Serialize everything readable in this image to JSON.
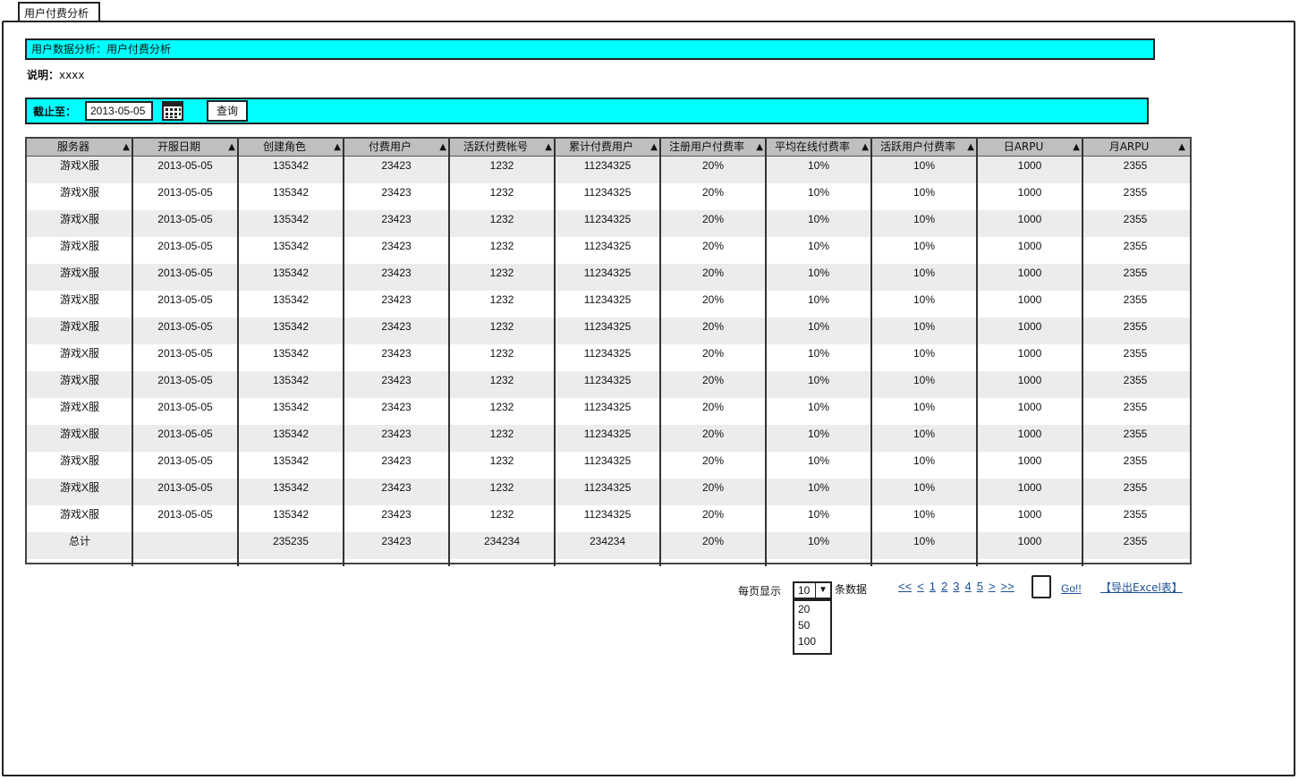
{
  "tab": {
    "label": "用户付费分析"
  },
  "title_bar": {
    "text": "用户数据分析：用户付费分析"
  },
  "description": {
    "label": "说明：",
    "value": "xxxx"
  },
  "query": {
    "label": "截止至：",
    "date_value": "2013-05-05",
    "calendar_icon": "calendar-icon",
    "button_label": "查询"
  },
  "table": {
    "columns": [
      "服务器",
      "开服日期",
      "创建角色",
      "付费用户",
      "活跃付费帐号",
      "累计付费用户",
      "注册用户付费率",
      "平均在线付费率",
      "活跃用户付费率",
      "日ARPU",
      "月ARPU"
    ],
    "sort_icon": "▲",
    "rows": [
      [
        "游戏X服",
        "2013-05-05",
        "135342",
        "23423",
        "1232",
        "11234325",
        "20%",
        "10%",
        "10%",
        "1000",
        "2355"
      ],
      [
        "游戏X服",
        "2013-05-05",
        "135342",
        "23423",
        "1232",
        "11234325",
        "20%",
        "10%",
        "10%",
        "1000",
        "2355"
      ],
      [
        "游戏X服",
        "2013-05-05",
        "135342",
        "23423",
        "1232",
        "11234325",
        "20%",
        "10%",
        "10%",
        "1000",
        "2355"
      ],
      [
        "游戏X服",
        "2013-05-05",
        "135342",
        "23423",
        "1232",
        "11234325",
        "20%",
        "10%",
        "10%",
        "1000",
        "2355"
      ],
      [
        "游戏X服",
        "2013-05-05",
        "135342",
        "23423",
        "1232",
        "11234325",
        "20%",
        "10%",
        "10%",
        "1000",
        "2355"
      ],
      [
        "游戏X服",
        "2013-05-05",
        "135342",
        "23423",
        "1232",
        "11234325",
        "20%",
        "10%",
        "10%",
        "1000",
        "2355"
      ],
      [
        "游戏X服",
        "2013-05-05",
        "135342",
        "23423",
        "1232",
        "11234325",
        "20%",
        "10%",
        "10%",
        "1000",
        "2355"
      ],
      [
        "游戏X服",
        "2013-05-05",
        "135342",
        "23423",
        "1232",
        "11234325",
        "20%",
        "10%",
        "10%",
        "1000",
        "2355"
      ],
      [
        "游戏X服",
        "2013-05-05",
        "135342",
        "23423",
        "1232",
        "11234325",
        "20%",
        "10%",
        "10%",
        "1000",
        "2355"
      ],
      [
        "游戏X服",
        "2013-05-05",
        "135342",
        "23423",
        "1232",
        "11234325",
        "20%",
        "10%",
        "10%",
        "1000",
        "2355"
      ],
      [
        "游戏X服",
        "2013-05-05",
        "135342",
        "23423",
        "1232",
        "11234325",
        "20%",
        "10%",
        "10%",
        "1000",
        "2355"
      ],
      [
        "游戏X服",
        "2013-05-05",
        "135342",
        "23423",
        "1232",
        "11234325",
        "20%",
        "10%",
        "10%",
        "1000",
        "2355"
      ],
      [
        "游戏X服",
        "2013-05-05",
        "135342",
        "23423",
        "1232",
        "11234325",
        "20%",
        "10%",
        "10%",
        "1000",
        "2355"
      ],
      [
        "游戏X服",
        "2013-05-05",
        "135342",
        "23423",
        "1232",
        "11234325",
        "20%",
        "10%",
        "10%",
        "1000",
        "2355"
      ]
    ],
    "total_row": [
      "总计",
      "",
      "235235",
      "23423",
      "234234",
      "234234",
      "20%",
      "10%",
      "10%",
      "1000",
      "2355"
    ]
  },
  "pager": {
    "per_page_label": "每页显示",
    "per_page_value": "10",
    "per_page_options": [
      "20",
      "50",
      "100"
    ],
    "rows_label": "条数据",
    "links": [
      "<<",
      "<",
      "1",
      "2",
      "3",
      "4",
      "5",
      ">",
      ">>"
    ],
    "go_label": "Go!!",
    "export_label": "【导出Excel表】"
  },
  "colors": {
    "accent": "#00ffff",
    "header_bg": "#bfbfbf",
    "alt_row": "#ececec",
    "link": "#1a4f99"
  }
}
